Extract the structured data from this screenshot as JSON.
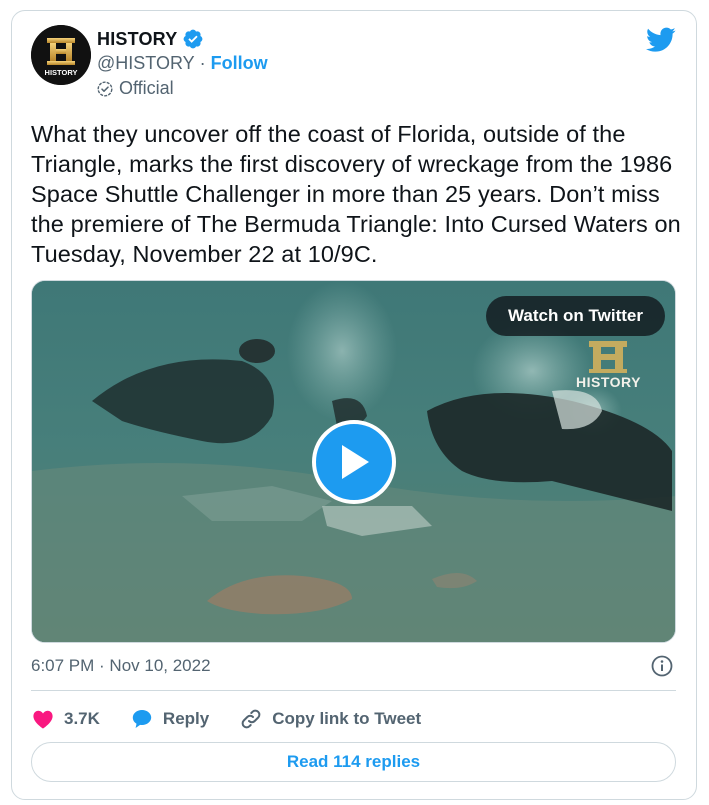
{
  "author": {
    "display_name": "HISTORY",
    "handle": "@HISTORY",
    "separator": "·",
    "follow_label": "Follow",
    "label": "Official",
    "avatar_text": "HISTORY",
    "avatar_icon": "history-h-logo",
    "verified_icon": "verified-badge-icon"
  },
  "brand_icon": "twitter-bird-icon",
  "tweet": {
    "text": "What they uncover off the coast of Florida, outside of the Triangle, marks the first discovery of wreckage from the 1986 Space Shuttle Challenger in more than 25 years. Don’t miss the premiere of The Bermuda Triangle: Into Cursed Waters on Tuesday, November 22 at 10/9C.",
    "timestamp": "6:07 PM · Nov 10, 2022"
  },
  "media": {
    "watch_label": "Watch on Twitter",
    "watermark_text": "HISTORY",
    "play_icon": "play-icon"
  },
  "actions": {
    "like_count": "3.7K",
    "reply_label": "Reply",
    "copy_label": "Copy link to Tweet"
  },
  "read_replies_label": "Read 114 replies",
  "colors": {
    "accent": "#1d9bf0",
    "like": "#f91880",
    "muted": "#536471",
    "border": "#cfd9de"
  }
}
